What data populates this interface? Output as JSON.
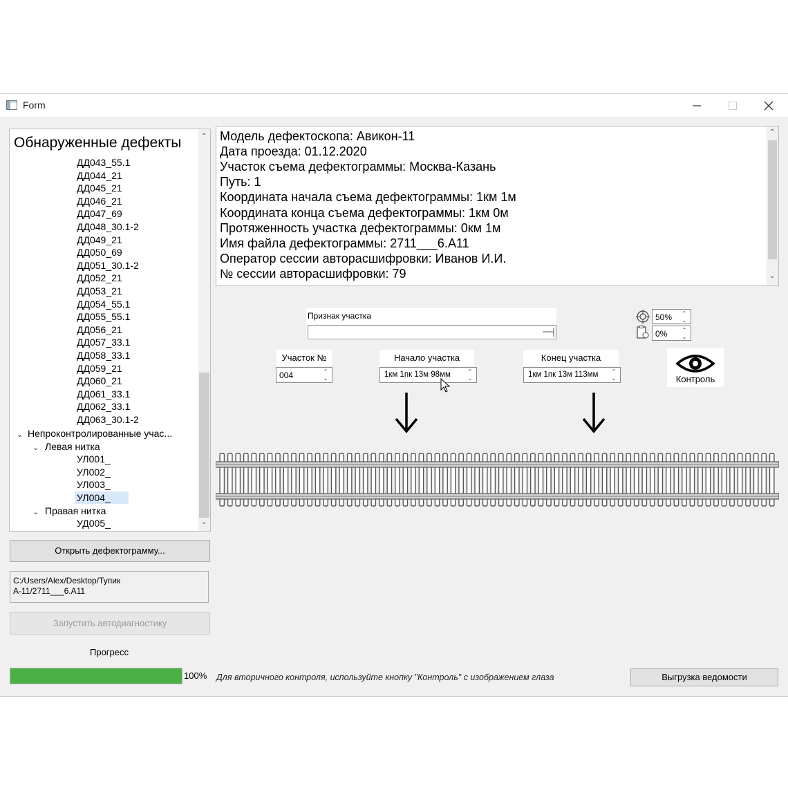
{
  "window": {
    "title": "Form"
  },
  "tree": {
    "header": "Обнаруженные дефекты",
    "defects": [
      "ДД043_55.1",
      "ДД044_21",
      "ДД045_21",
      "ДД046_21",
      "ДД047_69",
      "ДД048_30.1-2",
      "ДД049_21",
      "ДД050_69",
      "ДД051_30.1-2",
      "ДД052_21",
      "ДД053_21",
      "ДД054_55.1",
      "ДД055_55.1",
      "ДД056_21",
      "ДД057_33.1",
      "ДД058_33.1",
      "ДД059_21",
      "ДД060_21",
      "ДД061_33.1",
      "ДД062_33.1",
      "ДД063_30.1-2"
    ],
    "uncontrolled_group": "Непроконтролированные учас...",
    "left_rail": "Левая нитка",
    "left_items": [
      "УЛ001_",
      "УЛ002_",
      "УЛ003_",
      "УЛ004_"
    ],
    "selected_item": "УЛ004_",
    "right_rail": "Правая нитка",
    "right_items": [
      "УД005_"
    ]
  },
  "buttons": {
    "open": "Открыть дефектограмму...",
    "run": "Запустить автодиагностику",
    "export": "Выгрузка ведомости"
  },
  "file_path": [
    "C:/Users/Alex/Desktop/Тупик",
    "А-11/2711___6.A11"
  ],
  "progress": {
    "label": "Прогресс",
    "value": 1.0,
    "text": "100%",
    "color": "#4caf45"
  },
  "hint": "Для вторичного контроля, используйте кнопку \"Контроль\" с изображением глаза",
  "info_lines": [
    "Модель дефектоскопа: Авикон-11",
    "Дата проезда: 01.12.2020",
    "Участок съема дефектограммы: Москва-Казань",
    "Путь: 1",
    "Координата начала съема дефектограммы: 1км 1м",
    "Координата конца съема дефектограммы: 1км 0м",
    "Протяженность участка дефектограммы: 0км 1м",
    "Имя файла дефектограммы: 2711___6.A11",
    "Оператор сессии авторасшифровки: Иванов И.И.",
    "№ сессии авторасшифровки: 79"
  ],
  "section": {
    "sign_label": "Признак участка",
    "sign_value": "",
    "number_label": "Участок №",
    "number_value": "004",
    "start_label": "Начало участка",
    "start_value": "1км 1пк 13м 98мм",
    "end_label": "Конец участка",
    "end_value": "1км 1пк 13м 113мм"
  },
  "zoom": {
    "target_value": "50%",
    "doc_value": "0%"
  },
  "control": {
    "label": "Контроль",
    "icon": "eye-icon"
  }
}
